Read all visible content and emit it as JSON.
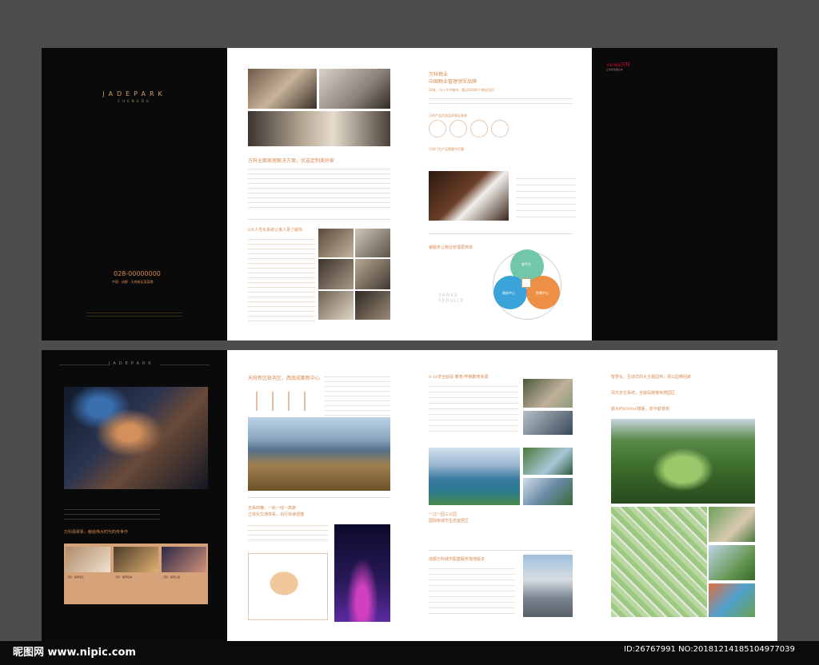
{
  "brand": {
    "project_name": "JADEPARK",
    "project_city": "CHENGDU",
    "phone": "028-00000000",
    "phone_sub": "中国 · 成都 · 天府新区某某路",
    "vanke_logo": "vanke万科",
    "vanke_logo_sub": "让建筑赞美生命",
    "service_text": "VANKE SERVICE"
  },
  "page2": {
    "heading1": "万科全面家居解决方案，优选定制美好家",
    "heading2": "6大人性化系统让家人更了解你"
  },
  "page3": {
    "heading1": "万科物业",
    "heading2": "中国物业管理领军品牌",
    "subheading": "20年，行十大中城市，超过20000个物业项目",
    "circles_title": "万科产品优选品质保证体系",
    "heading3": "万科门生产运营细节打磨",
    "venn_title": "睿服务让物业管理更简单",
    "venn": [
      "睿平台",
      "服务中心",
      "智慧中心",
      "服务中心"
    ]
  },
  "page5": {
    "heading1": "万科翡翠系，献给伟大时代的传世作",
    "thumb_labels": [
      "万科 · 翡翠滨江",
      "万科 · 翡翠名城",
      "万科 · 翡翠公园"
    ]
  },
  "page6": {
    "heading1": "天府新区政务区，西南成都新中心",
    "heading2": "五纵四横，一轨一线一高架",
    "heading3": "立体化交通体系，出行快速便捷"
  },
  "page7": {
    "heading1": "0-18岁全龄段 教育/学制教育资源",
    "heading2": "一江一园三公园",
    "heading3": "国际级城市生态宜居区",
    "heading4": "成都万科城市配套服务落地版本"
  },
  "page8": {
    "heading1": "智慧化、互动式的大主题园林，把公园带回家",
    "heading2": "风光定位系统，全龄段链接休憩园区",
    "heading3": "超大约6000㎡楼距，双中庭景观"
  },
  "watermark": {
    "site": "昵图网 www.nipic.com",
    "id": "ID:26767991 NO:20181214185104977039"
  },
  "colors": {
    "accent": "#d68a52",
    "gold": "#c8a16b",
    "dark": "#0a0a0a",
    "venn_green": "#6cc4a4",
    "venn_orange": "#ec8a3c",
    "venn_blue": "#2f9fd8"
  }
}
